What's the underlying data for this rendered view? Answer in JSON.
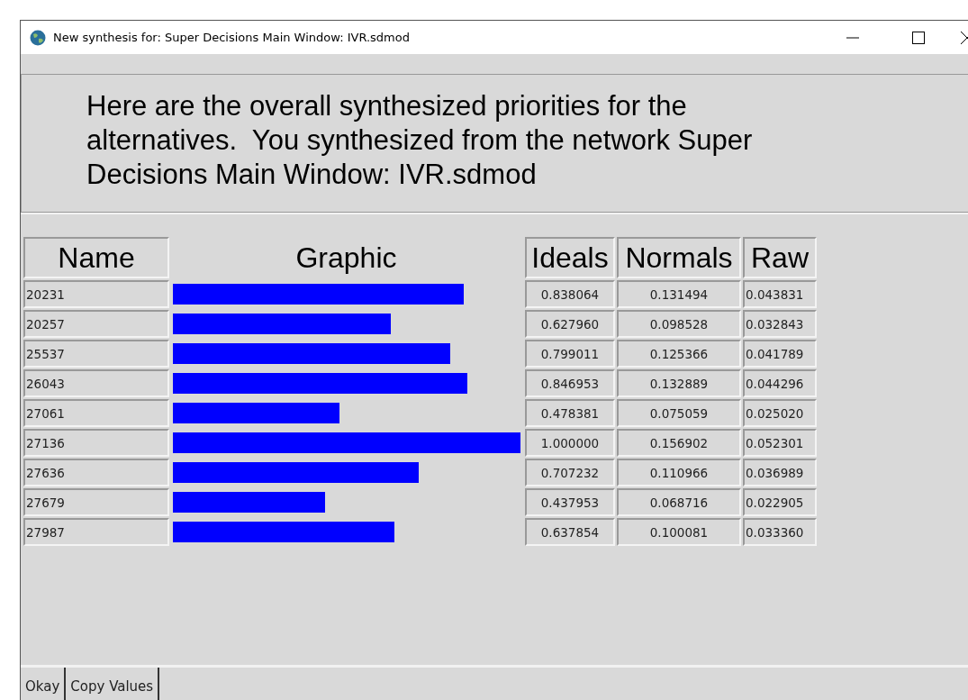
{
  "window": {
    "title": "New synthesis for: Super Decisions Main Window: IVR.sdmod"
  },
  "message": "Here are the overall synthesized priorities for the alternatives.  You synthesized from the network Super Decisions Main Window: IVR.sdmod",
  "table": {
    "columns": [
      "Name",
      "Graphic",
      "Ideals",
      "Normals",
      "Raw"
    ],
    "rows": [
      {
        "name": "20231",
        "level": 0.838064,
        "ideals": "0.838064",
        "normals": "0.131494",
        "raw": "0.043831"
      },
      {
        "name": "20257",
        "level": 0.62796,
        "ideals": "0.627960",
        "normals": "0.098528",
        "raw": "0.032843"
      },
      {
        "name": "25537",
        "level": 0.799011,
        "ideals": "0.799011",
        "normals": "0.125366",
        "raw": "0.041789"
      },
      {
        "name": "26043",
        "level": 0.846953,
        "ideals": "0.846953",
        "normals": "0.132889",
        "raw": "0.044296"
      },
      {
        "name": "27061",
        "level": 0.478381,
        "ideals": "0.478381",
        "normals": "0.075059",
        "raw": "0.025020"
      },
      {
        "name": "27136",
        "level": 1.0,
        "ideals": "1.000000",
        "normals": "0.156902",
        "raw": "0.052301"
      },
      {
        "name": "27636",
        "level": 0.707232,
        "ideals": "0.707232",
        "normals": "0.110966",
        "raw": "0.036989"
      },
      {
        "name": "27679",
        "level": 0.437953,
        "ideals": "0.437953",
        "normals": "0.068716",
        "raw": "0.022905"
      },
      {
        "name": "27987",
        "level": 0.637854,
        "ideals": "0.637854",
        "normals": "0.100081",
        "raw": "0.033360"
      }
    ]
  },
  "buttons": [
    "Okay",
    "Copy Values"
  ]
}
